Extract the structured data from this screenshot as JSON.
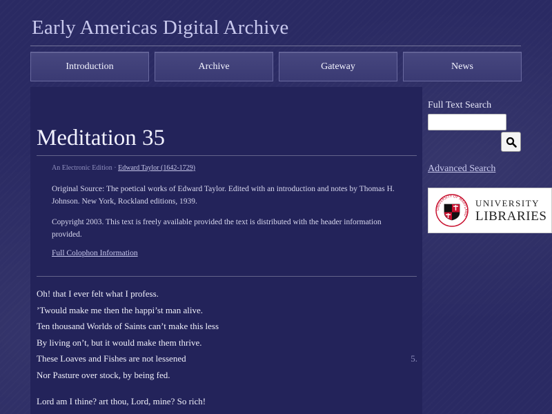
{
  "site": {
    "title": "Early Americas Digital Archive"
  },
  "nav": {
    "items": [
      {
        "label": "Introduction"
      },
      {
        "label": "Archive"
      },
      {
        "label": "Gateway"
      },
      {
        "label": "News"
      }
    ]
  },
  "document": {
    "title": "Meditation 35",
    "edition_label": "An Electronic Edition",
    "separator": " · ",
    "author": "Edward Taylor (1642-1729)",
    "source": "Original Source: The poetical works of Edward Taylor. Edited with an introduction and notes by Thomas H. Johnson. New York, Rockland editions, 1939.",
    "copyright": "Copyright 2003. This text is freely available provided the text is distributed with the header information provided.",
    "colophon_link": "Full Colophon Information"
  },
  "poem": {
    "lines": [
      {
        "text": "Oh! that I ever felt what I profess."
      },
      {
        "text": "’Twould make me then the happi’st man alive."
      },
      {
        "text": "Ten thousand Worlds of Saints can’t make this less"
      },
      {
        "text": "By living on’t, but it would make them thrive."
      },
      {
        "text": "These Loaves and Fishes are not lessened",
        "number": "5."
      },
      {
        "text": "Nor Pasture over stock, by being fed."
      }
    ],
    "next_stanza_first_line": "Lord am I thine? art thou, Lord, mine? So rich!"
  },
  "sidebar": {
    "search_label": "Full Text Search",
    "search_value": "",
    "advanced_search": "Advanced Search",
    "logo": {
      "seal_text": "UNIVERSITY OF MARYLAND",
      "line1": "UNIVERSITY",
      "line2": "LIBRARIES"
    }
  },
  "colors": {
    "background": "#2a2a63",
    "panel": "#23235a",
    "nav": "#3f3f78",
    "link": "#c9c9ee"
  }
}
